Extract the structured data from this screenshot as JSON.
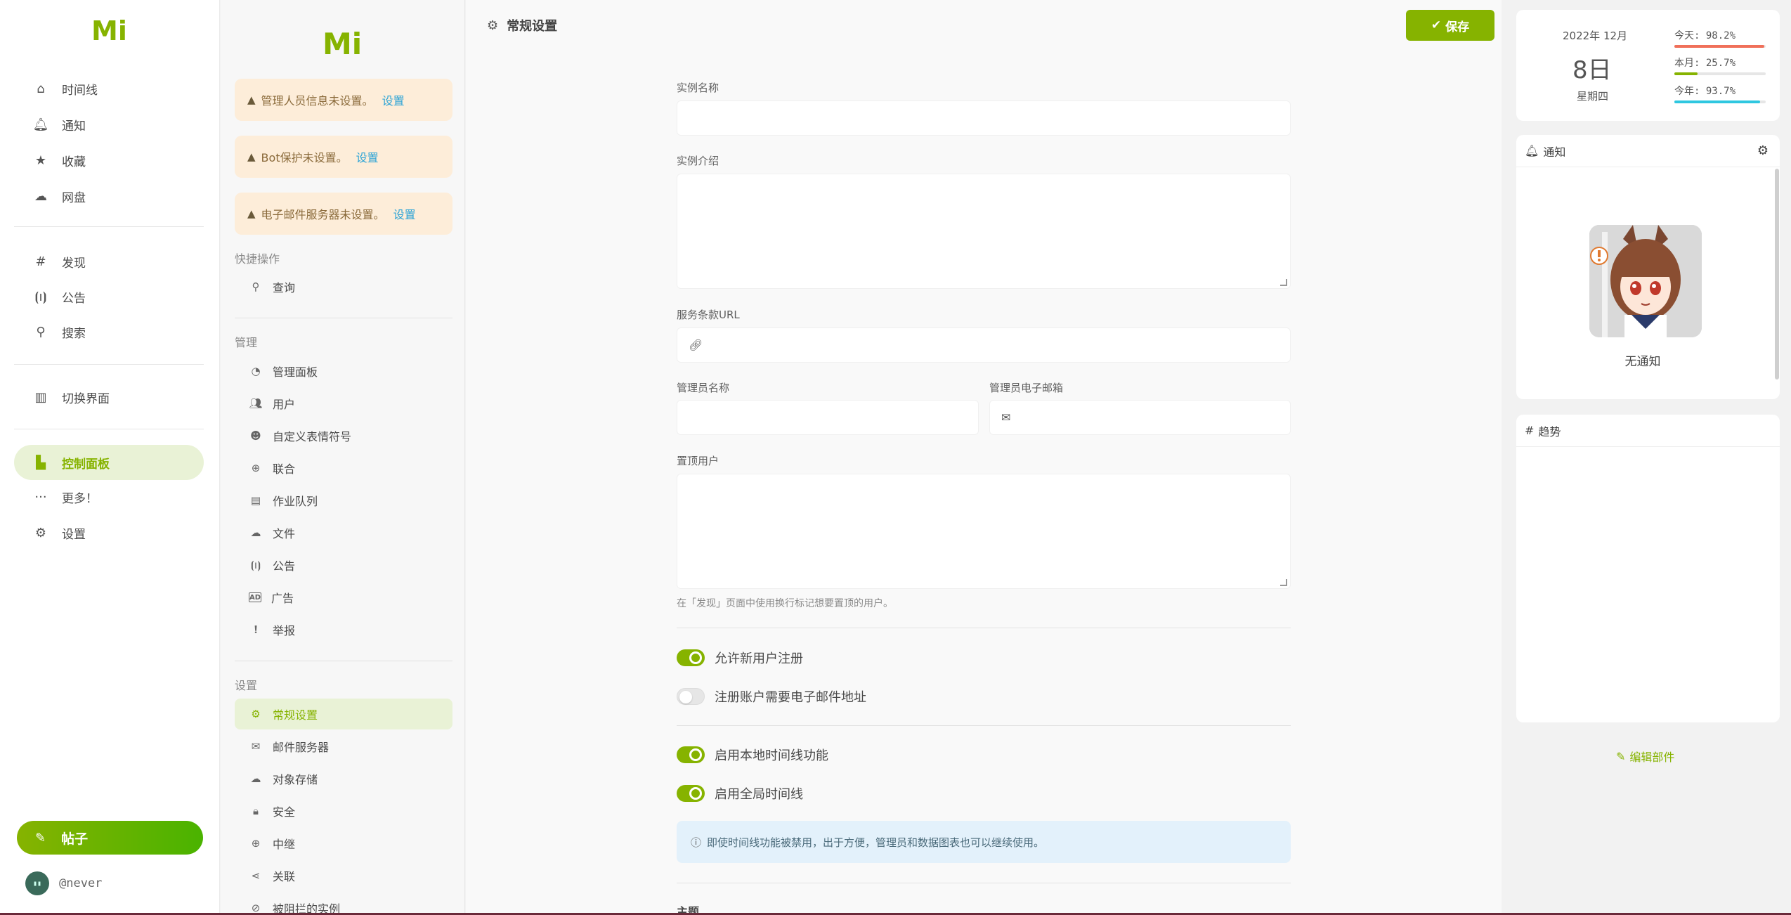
{
  "leftnav": {
    "logo": "Mi",
    "items": [
      {
        "label": "时间线",
        "icon": "home-icon"
      },
      {
        "label": "通知",
        "icon": "bell-icon"
      },
      {
        "label": "收藏",
        "icon": "star-icon"
      },
      {
        "label": "网盘",
        "icon": "cloud-icon"
      },
      {
        "label": "发现",
        "icon": "hash-icon"
      },
      {
        "label": "公告",
        "icon": "broadcast-icon"
      },
      {
        "label": "搜索",
        "icon": "search-icon"
      },
      {
        "label": "切换界面",
        "icon": "layout-icon"
      },
      {
        "label": "控制面板",
        "icon": "door-icon"
      },
      {
        "label": "更多！",
        "icon": "ellipsis-icon"
      },
      {
        "label": "设置",
        "icon": "gear-icon"
      }
    ],
    "post_label": "帖子",
    "account_name": "@never"
  },
  "setnav": {
    "logo": "Mi",
    "warnings": [
      {
        "text": "管理人员信息未设置。",
        "link": "设置"
      },
      {
        "text": "Bot保护未设置。",
        "link": "设置"
      },
      {
        "text": "电子邮件服务器未设置。",
        "link": "设置"
      }
    ],
    "quick_label": "快捷操作",
    "quick_items": [
      {
        "label": "查询"
      }
    ],
    "manage_label": "管理",
    "manage_items": [
      {
        "label": "管理面板"
      },
      {
        "label": "用户"
      },
      {
        "label": "自定义表情符号"
      },
      {
        "label": "联合"
      },
      {
        "label": "作业队列"
      },
      {
        "label": "文件"
      },
      {
        "label": "公告"
      },
      {
        "label": "广告"
      },
      {
        "label": "举报"
      }
    ],
    "settings_label": "设置",
    "settings_items": [
      {
        "label": "常规设置"
      },
      {
        "label": "邮件服务器"
      },
      {
        "label": "对象存储"
      },
      {
        "label": "安全"
      },
      {
        "label": "中继"
      },
      {
        "label": "关联"
      },
      {
        "label": "被阻拦的实例"
      }
    ]
  },
  "main": {
    "title": "常规设置",
    "save_label": "保存",
    "fields": {
      "instance_name": {
        "label": "实例名称",
        "value": ""
      },
      "instance_desc": {
        "label": "实例介绍",
        "value": ""
      },
      "tos_url": {
        "label": "服务条款URL",
        "value": ""
      },
      "admin_name": {
        "label": "管理员名称",
        "value": ""
      },
      "admin_email": {
        "label": "管理员电子邮箱",
        "value": ""
      },
      "pinned_users": {
        "label": "置顶用户",
        "value": "",
        "hint": "在「发现」页面中使用换行标记想要置顶的用户。"
      }
    },
    "toggles": [
      {
        "label": "允许新用户注册",
        "on": true
      },
      {
        "label": "注册账户需要电子邮件地址",
        "on": false
      },
      {
        "label": "启用本地时间线功能",
        "on": true
      },
      {
        "label": "启用全局时间线",
        "on": true
      }
    ],
    "info_text": "即使时间线功能被禁用，出于方便，管理员和数据图表也可以继续使用。",
    "next_section": "主题"
  },
  "widgets": {
    "calendar": {
      "year_month": "2022年 12月",
      "day": "8日",
      "weekday": "星期四",
      "stats": [
        {
          "label": "今天: 98.2%",
          "value": 0.982,
          "color": "#f0705a"
        },
        {
          "label": "本月: 25.7%",
          "value": 0.257,
          "color": "#86b300"
        },
        {
          "label": "今年: 93.7%",
          "value": 0.937,
          "color": "#2ec7e0"
        }
      ]
    },
    "notifications": {
      "title": "通知",
      "empty": "无通知"
    },
    "trends": {
      "title": "趋势"
    },
    "edit_label": "编辑部件"
  }
}
